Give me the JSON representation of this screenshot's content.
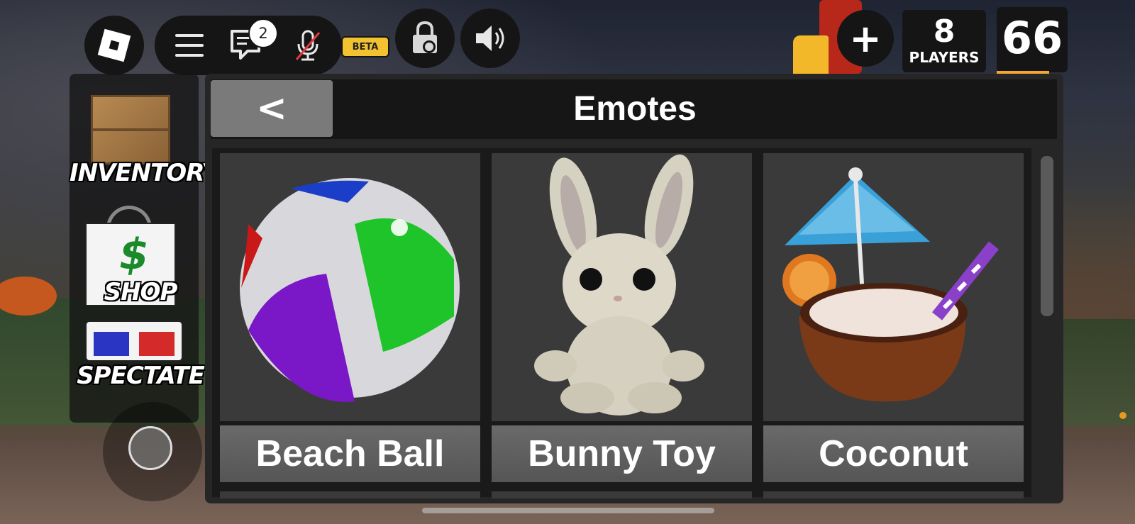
{
  "topbar": {
    "chat_badge": "2",
    "beta_label": "BETA",
    "plus_label": "+",
    "players_count": "8",
    "players_label": "PLAYERS",
    "counter": "66"
  },
  "left_menu": {
    "inventory": "INVENTORY",
    "shop": "SHOP",
    "spectate": "SPECTATE"
  },
  "panel": {
    "back_label": "<",
    "title": "Emotes"
  },
  "emotes": [
    {
      "label": "Beach Ball",
      "icon": "beach-ball-icon"
    },
    {
      "label": "Bunny Toy",
      "icon": "bunny-toy-icon"
    },
    {
      "label": "Coconut",
      "icon": "coconut-icon"
    }
  ],
  "colors": {
    "panel_bg": "#262626",
    "card_bg": "#3a3a3a",
    "label_bg": "#666666",
    "accent_orange": "#f2a530",
    "beta_yellow": "#f2c230"
  }
}
